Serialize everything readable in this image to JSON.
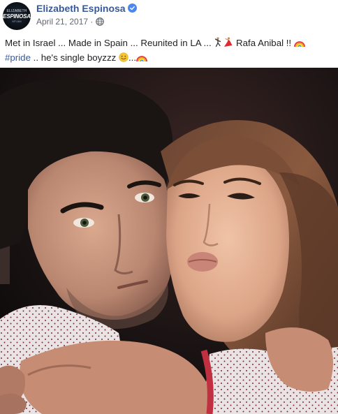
{
  "post": {
    "author": {
      "name": "Elizabeth Espinosa",
      "verified_icon": "verified-badge-icon",
      "avatar_text": {
        "line1": "ELIZABETH",
        "line2": "ESPINOSA",
        "line3": "KFI AM"
      }
    },
    "date": "April 21, 2017",
    "date_separator": "·",
    "audience_icon": "globe-icon",
    "text": {
      "line1_part1": "Met in Israel ... Made in Spain ... Reunited in LA ... ",
      "line1_part2": " Rafa Anibal !! ",
      "hashtag": "#pride",
      "line2_part": " .. he's single boyzzz ",
      "line2_end": "..."
    },
    "photo": {
      "icon": "photo-image"
    }
  },
  "colors": {
    "link": "#385898",
    "text": "#1c1e21",
    "meta": "#616770",
    "verified": "#4b87f0"
  }
}
